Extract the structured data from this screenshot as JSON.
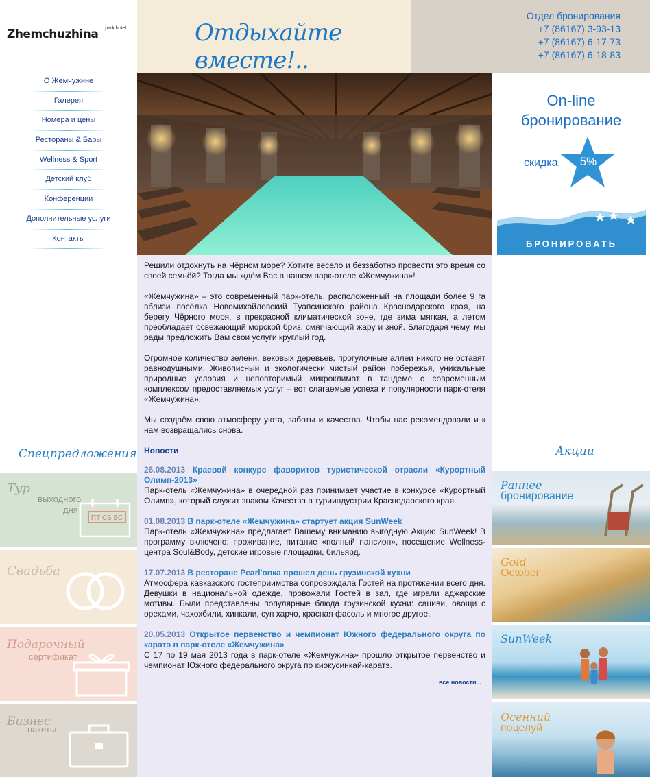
{
  "logo": {
    "name": "Zhemchuzhina",
    "sub": "park hotel"
  },
  "nav": [
    "О Жемчужине",
    "Галерея",
    "Номера и цены",
    "Рестораны & Бары",
    "Wellness & Sport",
    "Детский клуб",
    "Конференции",
    "Дополнительные услуги",
    "Контакты"
  ],
  "header": {
    "slogan": "Отдыхайте вместе!..",
    "booking_title": "Отдел бронирования",
    "phones": [
      "+7 (86167) 3-93-13",
      "+7 (86167) 6-17-73",
      "+7 (86167) 6-18-83"
    ]
  },
  "left_promos": {
    "title": "Спецпредложения",
    "tour": {
      "line1": "Тур",
      "line2": "выходного",
      "line3": "дня",
      "calendar": "ПТ СБ ВС"
    },
    "wedding": "Свадьба",
    "gift": {
      "line1": "Подарочный",
      "line2": "сертификат"
    },
    "business": {
      "line1": "Бизнес",
      "line2": "пакеты"
    }
  },
  "right_promos": {
    "online_line1": "On-line",
    "online_line2": "бронирование",
    "discount_label": "скидка",
    "discount_value": "5%",
    "book_button": "БРОНИРОВАТЬ",
    "title": "Акции",
    "early": {
      "line1": "Раннее",
      "line2": "бронирование"
    },
    "gold": {
      "line1": "Gold",
      "line2": "October"
    },
    "sunweek": "SunWeek",
    "autumn": {
      "line1": "Осенний",
      "line2": "поцелуй"
    }
  },
  "content": {
    "p1": "Решили отдохнуть на Чёрном море? Хотите весело и беззаботно провести это время со своей семьёй? Тогда мы ждём Вас в нашем парк-отеле «Жемчужина»!",
    "p2": "«Жемчужина» – это современный парк-отель, расположенный на площади более 9 га вблизи посёлка Новомихайловский Туапсинского района Краснодарского края, на берегу Чёрного моря, в прекрасной климатической зоне, где зима мягкая, а летом преобладает освежающий морской бриз, смягчающий жару и зной. Благодаря чему, мы рады предложить Вам свои услуги круглый год.",
    "p3": "Огромное количество зелени, вековых деревьев, прогулочные аллеи никого не оставят равнодушными. Живописный и экологически чистый район побережья, уникальные природные условия и неповторимый микроклимат в тандеме с современным комплексом предоставляемых услуг – вот слагаемые успеха и популярности парк-отеля «Жемчужина».",
    "p4": "Мы создаём свою атмосферу уюта, заботы и качества. Чтобы нас рекомендовали и к нам возвращались снова."
  },
  "news": {
    "heading": "Новости",
    "items": [
      {
        "date": "26.08.2013",
        "title": "Краевой конкурс фаворитов туристической отрасли «Курортный Олимп-2013»",
        "text": "Парк-отель «Жемчужина» в очередной раз принимает участие в конкурсе «Курортный Олимп», который служит знаком Качества в турииндустрии Краснодарского края."
      },
      {
        "date": "01.08.2013",
        "title": "В парк-отеле «Жемчужина» стартует акция SunWeek",
        "text": "Парк-отель «Жемчужина» предлагает Вашему вниманию выгодную Акцию SunWeek! В программу включено: проживание, питание «полный пансион», посещение Wellness-центра Soul&Body, детские игровые площадки, бильярд."
      },
      {
        "date": "17.07.2013",
        "title": "В ресторане Pearl'овка прошел день грузинской кухни",
        "text": "Атмосфера кавказского гостеприимства сопровождала Гостей на протяжении всего дня. Девушки в национальной одежде, провожали Гостей в зал, где играли аджарские мотивы. Были представлены популярные блюда грузинской кухни: сациви, овощи с орехами, чахохбили, хинкали, суп харчо, красная фасоль и многое другое."
      },
      {
        "date": "20.05.2013",
        "title": "Открытое первенство и чемпионат Южного федерального округа по каратэ в парк-отеле «Жемчужина»",
        "text": "С 17 по 19 мая 2013 года в парк-отеле «Жемчужина» прошло открытое первенство и чемпионат Южного федерального округа по киокусинкай-каратэ."
      }
    ],
    "all": "все новости..."
  },
  "colors": {
    "accent": "#1d6fc4",
    "nav": "#1a3f8a",
    "center_bg": "#ece9f7",
    "header_bg": "#f5ebd9"
  }
}
